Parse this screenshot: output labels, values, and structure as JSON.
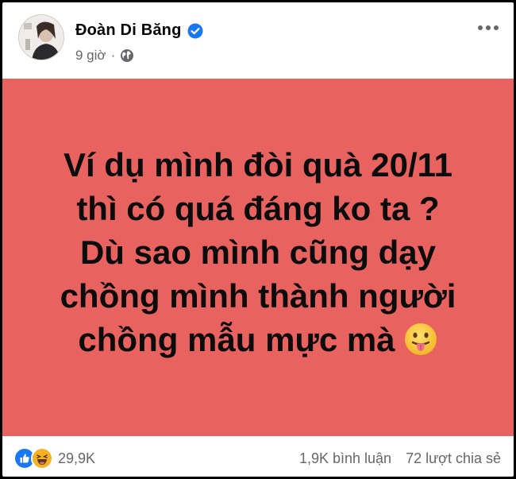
{
  "post": {
    "author": {
      "name": "Đoàn Di Băng",
      "verified_icon": "verified-badge-icon",
      "avatar_icon": "avatar"
    },
    "meta": {
      "time": "9 giờ",
      "separator": "·",
      "audience_icon": "globe-icon"
    },
    "more_icon": "more-options-icon",
    "content": {
      "background_color": "#e8625f",
      "lines": [
        "Ví dụ mình đòi quà 20/11",
        "thì có quá đáng ko ta ?",
        "Dù sao mình cũng dạy",
        "chồng mình thành người",
        "chồng mẫu mực mà"
      ],
      "emoji": "tongue-out-emoji-icon"
    },
    "footer": {
      "reaction_icons": [
        "like-icon",
        "haha-icon"
      ],
      "reaction_count": "29,9K",
      "comments": "1,9K bình luận",
      "shares": "72 lượt chia sẻ"
    }
  },
  "colors": {
    "accent_blue": "#1877f2",
    "secondary_text": "#65676b",
    "haha_yellow": "#f7b125"
  }
}
